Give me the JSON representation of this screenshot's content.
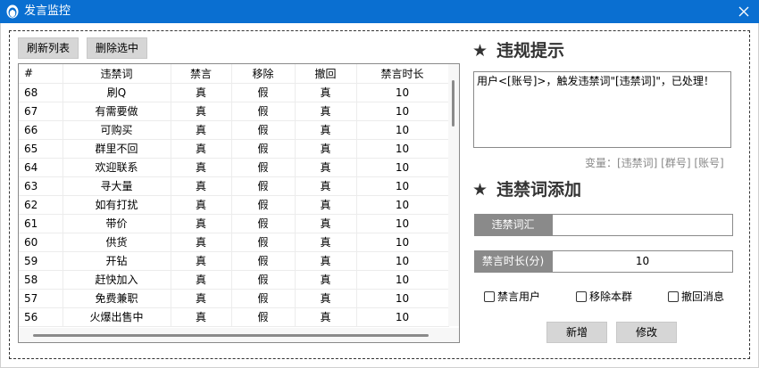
{
  "window": {
    "title": "发言监控"
  },
  "toolbar": {
    "refresh_label": "刷新列表",
    "delete_label": "删除选中"
  },
  "table": {
    "columns": [
      "#",
      "违禁词",
      "禁言",
      "移除",
      "撤回",
      "禁言时长"
    ],
    "rows": [
      [
        "68",
        "刷Q",
        "真",
        "假",
        "真",
        "10"
      ],
      [
        "67",
        "有需要做",
        "真",
        "假",
        "真",
        "10"
      ],
      [
        "66",
        "可购买",
        "真",
        "假",
        "真",
        "10"
      ],
      [
        "65",
        "群里不回",
        "真",
        "假",
        "真",
        "10"
      ],
      [
        "64",
        "欢迎联系",
        "真",
        "假",
        "真",
        "10"
      ],
      [
        "63",
        "寻大量",
        "真",
        "假",
        "真",
        "10"
      ],
      [
        "62",
        "如有打扰",
        "真",
        "假",
        "真",
        "10"
      ],
      [
        "61",
        "带价",
        "真",
        "假",
        "真",
        "10"
      ],
      [
        "60",
        "供货",
        "真",
        "假",
        "真",
        "10"
      ],
      [
        "59",
        "开钻",
        "真",
        "假",
        "真",
        "10"
      ],
      [
        "58",
        "赶快加入",
        "真",
        "假",
        "真",
        "10"
      ],
      [
        "57",
        "免费兼职",
        "真",
        "假",
        "真",
        "10"
      ],
      [
        "56",
        "火爆出售中",
        "真",
        "假",
        "真",
        "10"
      ]
    ]
  },
  "violation_notice": {
    "title": "违规提示",
    "template": "用户<[账号]>，触发违禁词\"[违禁词]\"，已处理！",
    "variables_hint": "变量：[违禁词] [群号] [账号]"
  },
  "add_word": {
    "title": "违禁词添加",
    "word_label": "违禁词汇",
    "word_value": "",
    "duration_label": "禁言时长(分)",
    "duration_value": "10",
    "checkboxes": {
      "mute_user": "禁言用户",
      "remove_from_group": "移除本群",
      "recall_message": "撤回消息"
    },
    "add_label": "新增",
    "edit_label": "修改"
  },
  "colors": {
    "titlebar": "#0a6fd1",
    "label_bg": "#8a8a8a",
    "button_bg": "#d6d6d6"
  }
}
